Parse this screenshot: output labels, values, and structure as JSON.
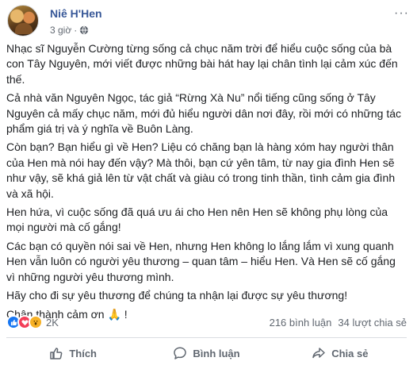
{
  "post": {
    "author": "Niê H'Hen",
    "time": "3 giờ",
    "time_separator": "·",
    "more": "···",
    "paragraphs": [
      "Nhạc sĩ Nguyễn Cường từng sống cả chục năm trời để hiểu cuộc sống của bà con Tây Nguyên, mới viết được những bài hát hay lại chân tình lại cảm xúc đến thế.",
      "Cả nhà văn Nguyên Ngọc, tác giả “Rừng Xà Nu” nổi tiếng cũng sống ở Tây Nguyên cả mấy chục năm, mới đủ hiểu người dân nơi đây, rồi mới có những tác phẩm giá trị và ý nghĩa về Buôn Làng.",
      "Còn bạn? Bạn hiểu gì về Hen? Liệu có chăng bạn là hàng xóm hay người thân của Hen mà nói hay đến vậy? Mà thôi, bạn cứ yên tâm, từ nay gia đình Hen sẽ như vậy, sẽ khá giả lên từ vật chất và giàu có trong tinh thần, tình cảm gia đình và xã hội.",
      "Hen hứa, vì cuộc sống đã quá ưu ái cho Hen nên Hen sẽ không phụ lòng của mọi người mà cố gắng!",
      "Các bạn có quyền nói sai về Hen, nhưng Hen không lo lắng lắm vì xung quanh Hen vẫn luôn có người yêu thương – quan tâm – hiểu Hen. Và Hen sẽ cố gắng vì những người yêu thương mình.",
      "Hãy cho đi sự yêu thương để chúng ta nhận lại được sự yêu thương!",
      "Chân thành cảm ơn 🙏 !"
    ]
  },
  "reactions": {
    "icons": [
      "like-icon",
      "love-icon",
      "wow-icon"
    ],
    "count": "2K",
    "comments": "216 bình luận",
    "shares": "34 lượt chia sẻ"
  },
  "actions": {
    "like": "Thích",
    "comment": "Bình luận",
    "share": "Chia sẻ"
  },
  "colors": {
    "author": "#385898",
    "like": "#1877f2",
    "love": "#f33e58",
    "wow": "#f7b125"
  }
}
